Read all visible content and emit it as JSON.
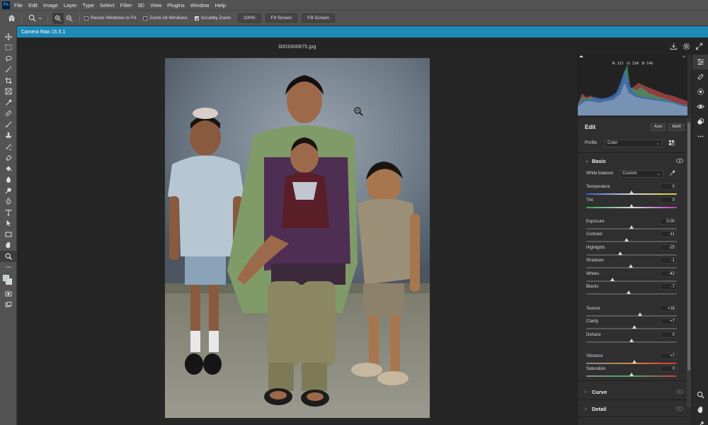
{
  "menu": {
    "items": [
      "File",
      "Edit",
      "Image",
      "Layer",
      "Type",
      "Select",
      "Filter",
      "3D",
      "View",
      "Plugins",
      "Window",
      "Help"
    ]
  },
  "options_bar": {
    "resize_windows": "Resize Windows to Fit",
    "zoom_all": "Zoom All Windows",
    "scrubby_zoom": "Scrubby Zoom",
    "zoom_value": "100%",
    "fit_screen": "Fit Screen",
    "fill_screen": "Fill Screen"
  },
  "camera_raw": {
    "title": "Camera Raw 15.5.1",
    "filename": "3003300875.jpg"
  },
  "histogram": {
    "r_label": "R:",
    "r_value": "121",
    "g_label": "G:",
    "g_value": "134",
    "b_label": "B:",
    "b_value": "140"
  },
  "edit_panel": {
    "title": "Edit",
    "auto": "Auto",
    "bw": "B&W",
    "profile_label": "Profile",
    "profile_value": "Color",
    "basic": {
      "title": "Basic",
      "white_balance_label": "White balance",
      "white_balance_value": "Custom",
      "sliders": [
        {
          "label": "Temperature",
          "value": "0",
          "pos": 0.5
        },
        {
          "label": "Tint",
          "value": "0",
          "pos": 0.5
        },
        {
          "label": "Exposure",
          "value": "0.00",
          "pos": 0.5
        },
        {
          "label": "Contrast",
          "value": "-11",
          "pos": 0.445
        },
        {
          "label": "Highlights",
          "value": "-25",
          "pos": 0.375
        },
        {
          "label": "Shadows",
          "value": "-1",
          "pos": 0.495
        },
        {
          "label": "Whites",
          "value": "-42",
          "pos": 0.29
        },
        {
          "label": "Blacks",
          "value": "-7",
          "pos": 0.465
        },
        {
          "label": "Texture",
          "value": "+18",
          "pos": 0.59
        },
        {
          "label": "Clarity",
          "value": "+7",
          "pos": 0.535
        },
        {
          "label": "Dehaze",
          "value": "0",
          "pos": 0.5
        },
        {
          "label": "Vibrance",
          "value": "+7",
          "pos": 0.535
        },
        {
          "label": "Saturation",
          "value": "0",
          "pos": 0.5
        }
      ]
    },
    "curve": "Curve",
    "detail": "Detail"
  }
}
